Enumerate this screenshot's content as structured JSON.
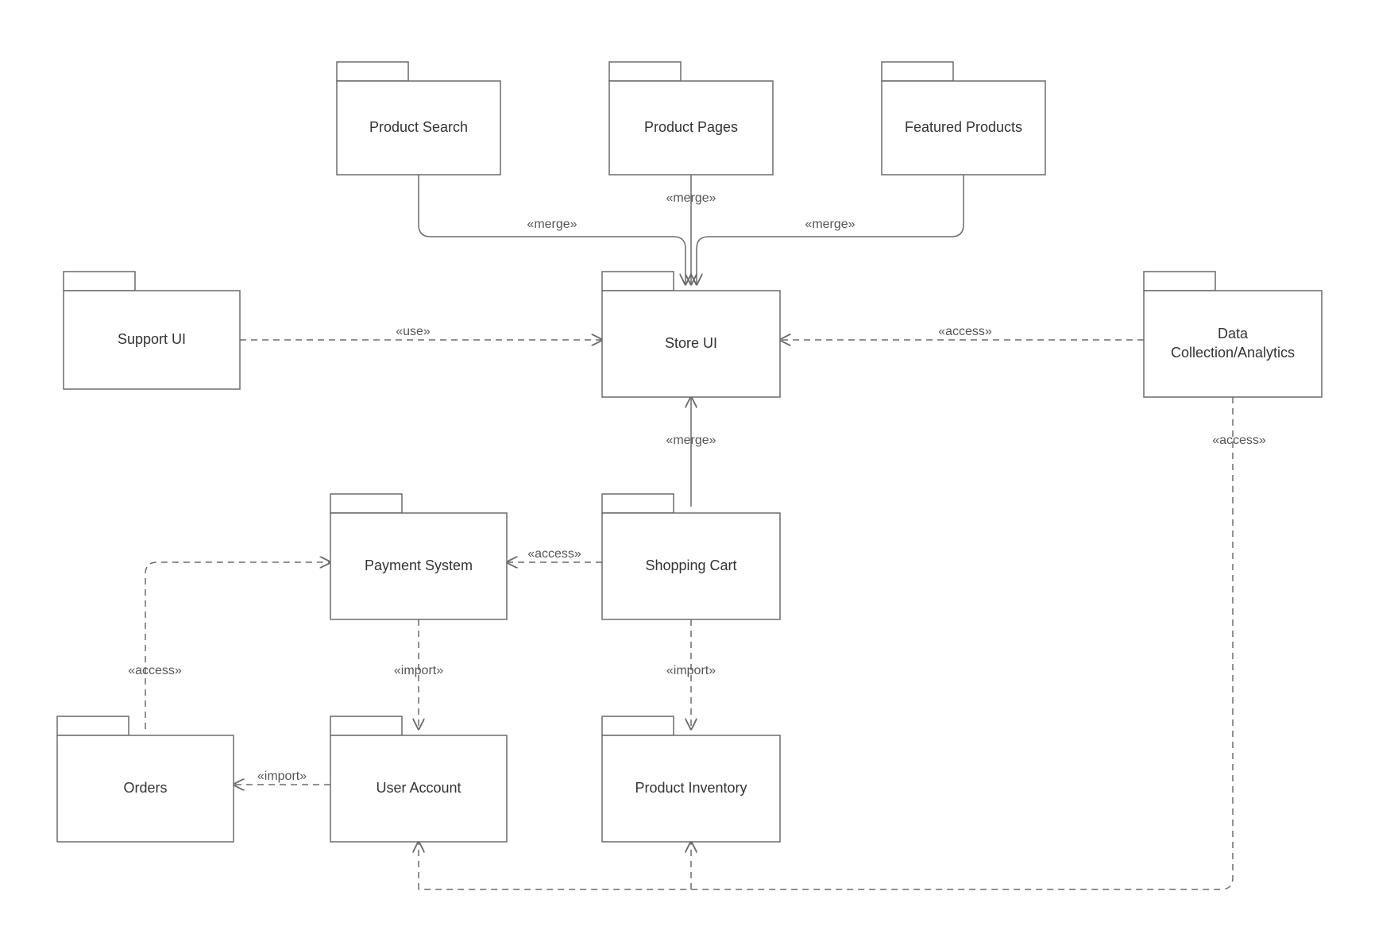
{
  "packages": {
    "productSearch": {
      "label": "Product Search"
    },
    "productPages": {
      "label": "Product Pages"
    },
    "featuredProducts": {
      "label": "Featured Products"
    },
    "supportUI": {
      "label": "Support UI"
    },
    "storeUI": {
      "label": "Store UI"
    },
    "dataAnalytics": {
      "label": "Data\nCollection/Analytics"
    },
    "paymentSystem": {
      "label": "Payment System"
    },
    "shoppingCart": {
      "label": "Shopping Cart"
    },
    "orders": {
      "label": "Orders"
    },
    "userAccount": {
      "label": "User Account"
    },
    "productInventory": {
      "label": "Product Inventory"
    }
  },
  "relations": {
    "merge": "«merge»",
    "use": "«use»",
    "access": "«access»",
    "import": "«import»"
  },
  "edges": [
    {
      "from": "productSearch",
      "to": "storeUI",
      "type": "merge",
      "dashed": false
    },
    {
      "from": "productPages",
      "to": "storeUI",
      "type": "merge",
      "dashed": false
    },
    {
      "from": "featuredProducts",
      "to": "storeUI",
      "type": "merge",
      "dashed": false
    },
    {
      "from": "supportUI",
      "to": "storeUI",
      "type": "use",
      "dashed": true
    },
    {
      "from": "dataAnalytics",
      "to": "storeUI",
      "type": "access",
      "dashed": true
    },
    {
      "from": "shoppingCart",
      "to": "storeUI",
      "type": "merge",
      "dashed": false
    },
    {
      "from": "shoppingCart",
      "to": "paymentSystem",
      "type": "access",
      "dashed": true
    },
    {
      "from": "paymentSystem",
      "to": "userAccount",
      "type": "import",
      "dashed": true
    },
    {
      "from": "shoppingCart",
      "to": "productInventory",
      "type": "import",
      "dashed": true
    },
    {
      "from": "userAccount",
      "to": "orders",
      "type": "import",
      "dashed": true
    },
    {
      "from": "orders",
      "to": "paymentSystem",
      "type": "access",
      "dashed": true
    },
    {
      "from": "dataAnalytics",
      "to": "userAccount",
      "type": "access",
      "dashed": true
    },
    {
      "from": "dataAnalytics",
      "to": "productInventory",
      "type": "access",
      "dashed": true
    }
  ]
}
